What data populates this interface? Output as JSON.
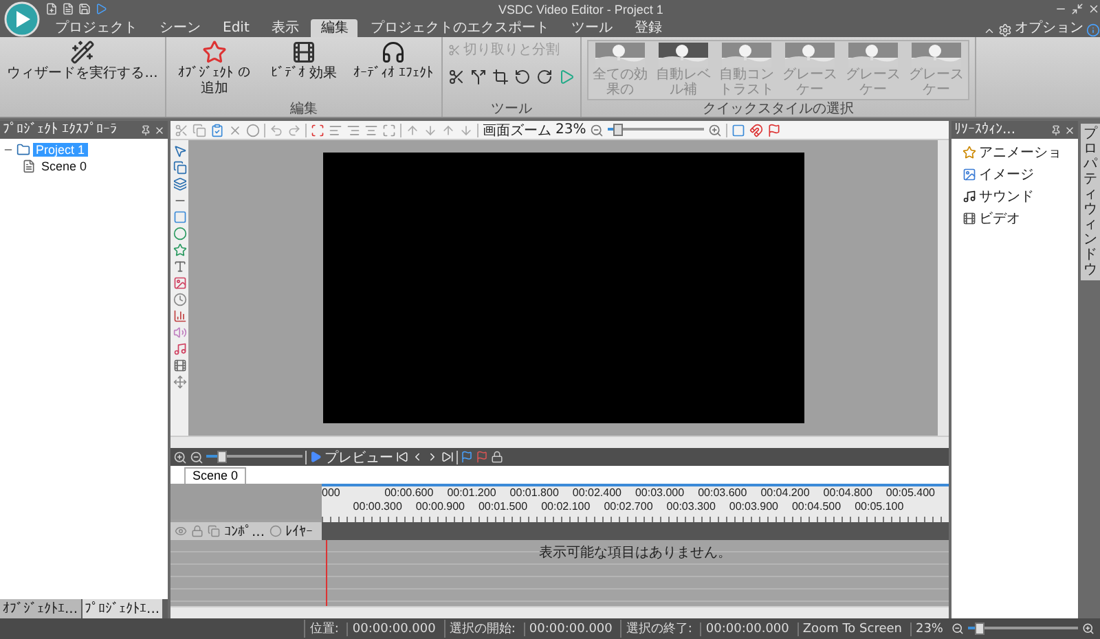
{
  "window": {
    "title": "VSDC Video Editor - Project 1"
  },
  "menu_tabs": [
    {
      "label": "プロジェクト",
      "selected": false
    },
    {
      "label": "シーン",
      "selected": false
    },
    {
      "label": "Edit",
      "selected": false
    },
    {
      "label": "表示",
      "selected": false
    },
    {
      "label": "編集",
      "selected": true
    },
    {
      "label": "プロジェクトのエクスポート",
      "selected": false
    },
    {
      "label": "ツール",
      "selected": false
    },
    {
      "label": "登録",
      "selected": false
    }
  ],
  "options": {
    "label": "オプション"
  },
  "ribbon": {
    "wizard": {
      "label": "ウィザードを実行する..."
    },
    "groups": [
      {
        "kind": "edit",
        "label": "編集",
        "buttons": [
          "ｵﾌﾞｼﾞｪｸﾄ の追加",
          "ﾋﾞﾃﾞｵ 効果",
          "ｵｰﾃﾞｨｵ ｴﾌｪｸﾄ"
        ]
      },
      {
        "kind": "tools",
        "label": "ツール",
        "action": {
          "label": "切り取りと分割",
          "disabled": true
        }
      },
      {
        "kind": "styles",
        "label": "クイックスタイルの選択",
        "styles": [
          "全ての効果の",
          "自動レベル補",
          "自動コントラスト",
          "グレースケー",
          "グレースケー",
          "グレースケー"
        ]
      }
    ]
  },
  "project_explorer": {
    "title": "ﾌﾟﾛｼﾞｪｸﾄ ｴｸｽﾌﾟﾛｰﾗ",
    "tree": [
      {
        "label": "Project 1",
        "selected": true,
        "expanded": true,
        "children": [
          {
            "label": "Scene 0",
            "selected": false
          }
        ]
      }
    ],
    "bottom_tabs": [
      {
        "label": "ｵﾌﾞｼﾞｪｸﾄｴ...",
        "selected": false
      },
      {
        "label": "ﾌﾟﾛｼﾞｪｸﾄｴ...",
        "selected": true
      }
    ]
  },
  "editor_toolbar": {
    "zoom": {
      "label": "画面ズーム",
      "value": "23%",
      "level": 0.1
    }
  },
  "timeline": {
    "preview": "プレビュー",
    "zoom": {
      "level": 0.15
    },
    "scene_tab": "Scene 0",
    "ruler": [
      "000",
      "00:00.300",
      "00:00.600",
      "00:00.900",
      "00:01.200",
      "00:01.500",
      "00:01.800",
      "00:02.100",
      "00:02.400",
      "00:02.700",
      "00:03.000",
      "00:03.300",
      "00:03.600",
      "00:03.900",
      "00:04.200",
      "00:04.500",
      "00:04.800",
      "00:05.100",
      "00:05.400"
    ],
    "columns": [
      "ｺﾝﾎﾟ...",
      "ﾚｲﾔｰ"
    ],
    "empty_message": "表示可能な項目はありません。"
  },
  "resources": {
    "title": "ﾘｿｰｽｳｨﾝ...",
    "items": [
      "アニメーショ",
      "イメージ",
      "サウンド",
      "ビデオ"
    ]
  },
  "side_tab": {
    "label": "プロパティウィンドウ"
  },
  "status_bar": {
    "fields": [
      {
        "label": "位置:",
        "value": "00:00:00.000"
      },
      {
        "label": "選択の開始:",
        "value": "00:00:00.000"
      },
      {
        "label": "選択の終了:",
        "value": "00:00:00.000"
      }
    ],
    "zoom_mode": "Zoom To Screen",
    "zoom": {
      "value": "23%",
      "level": 0.1
    }
  }
}
